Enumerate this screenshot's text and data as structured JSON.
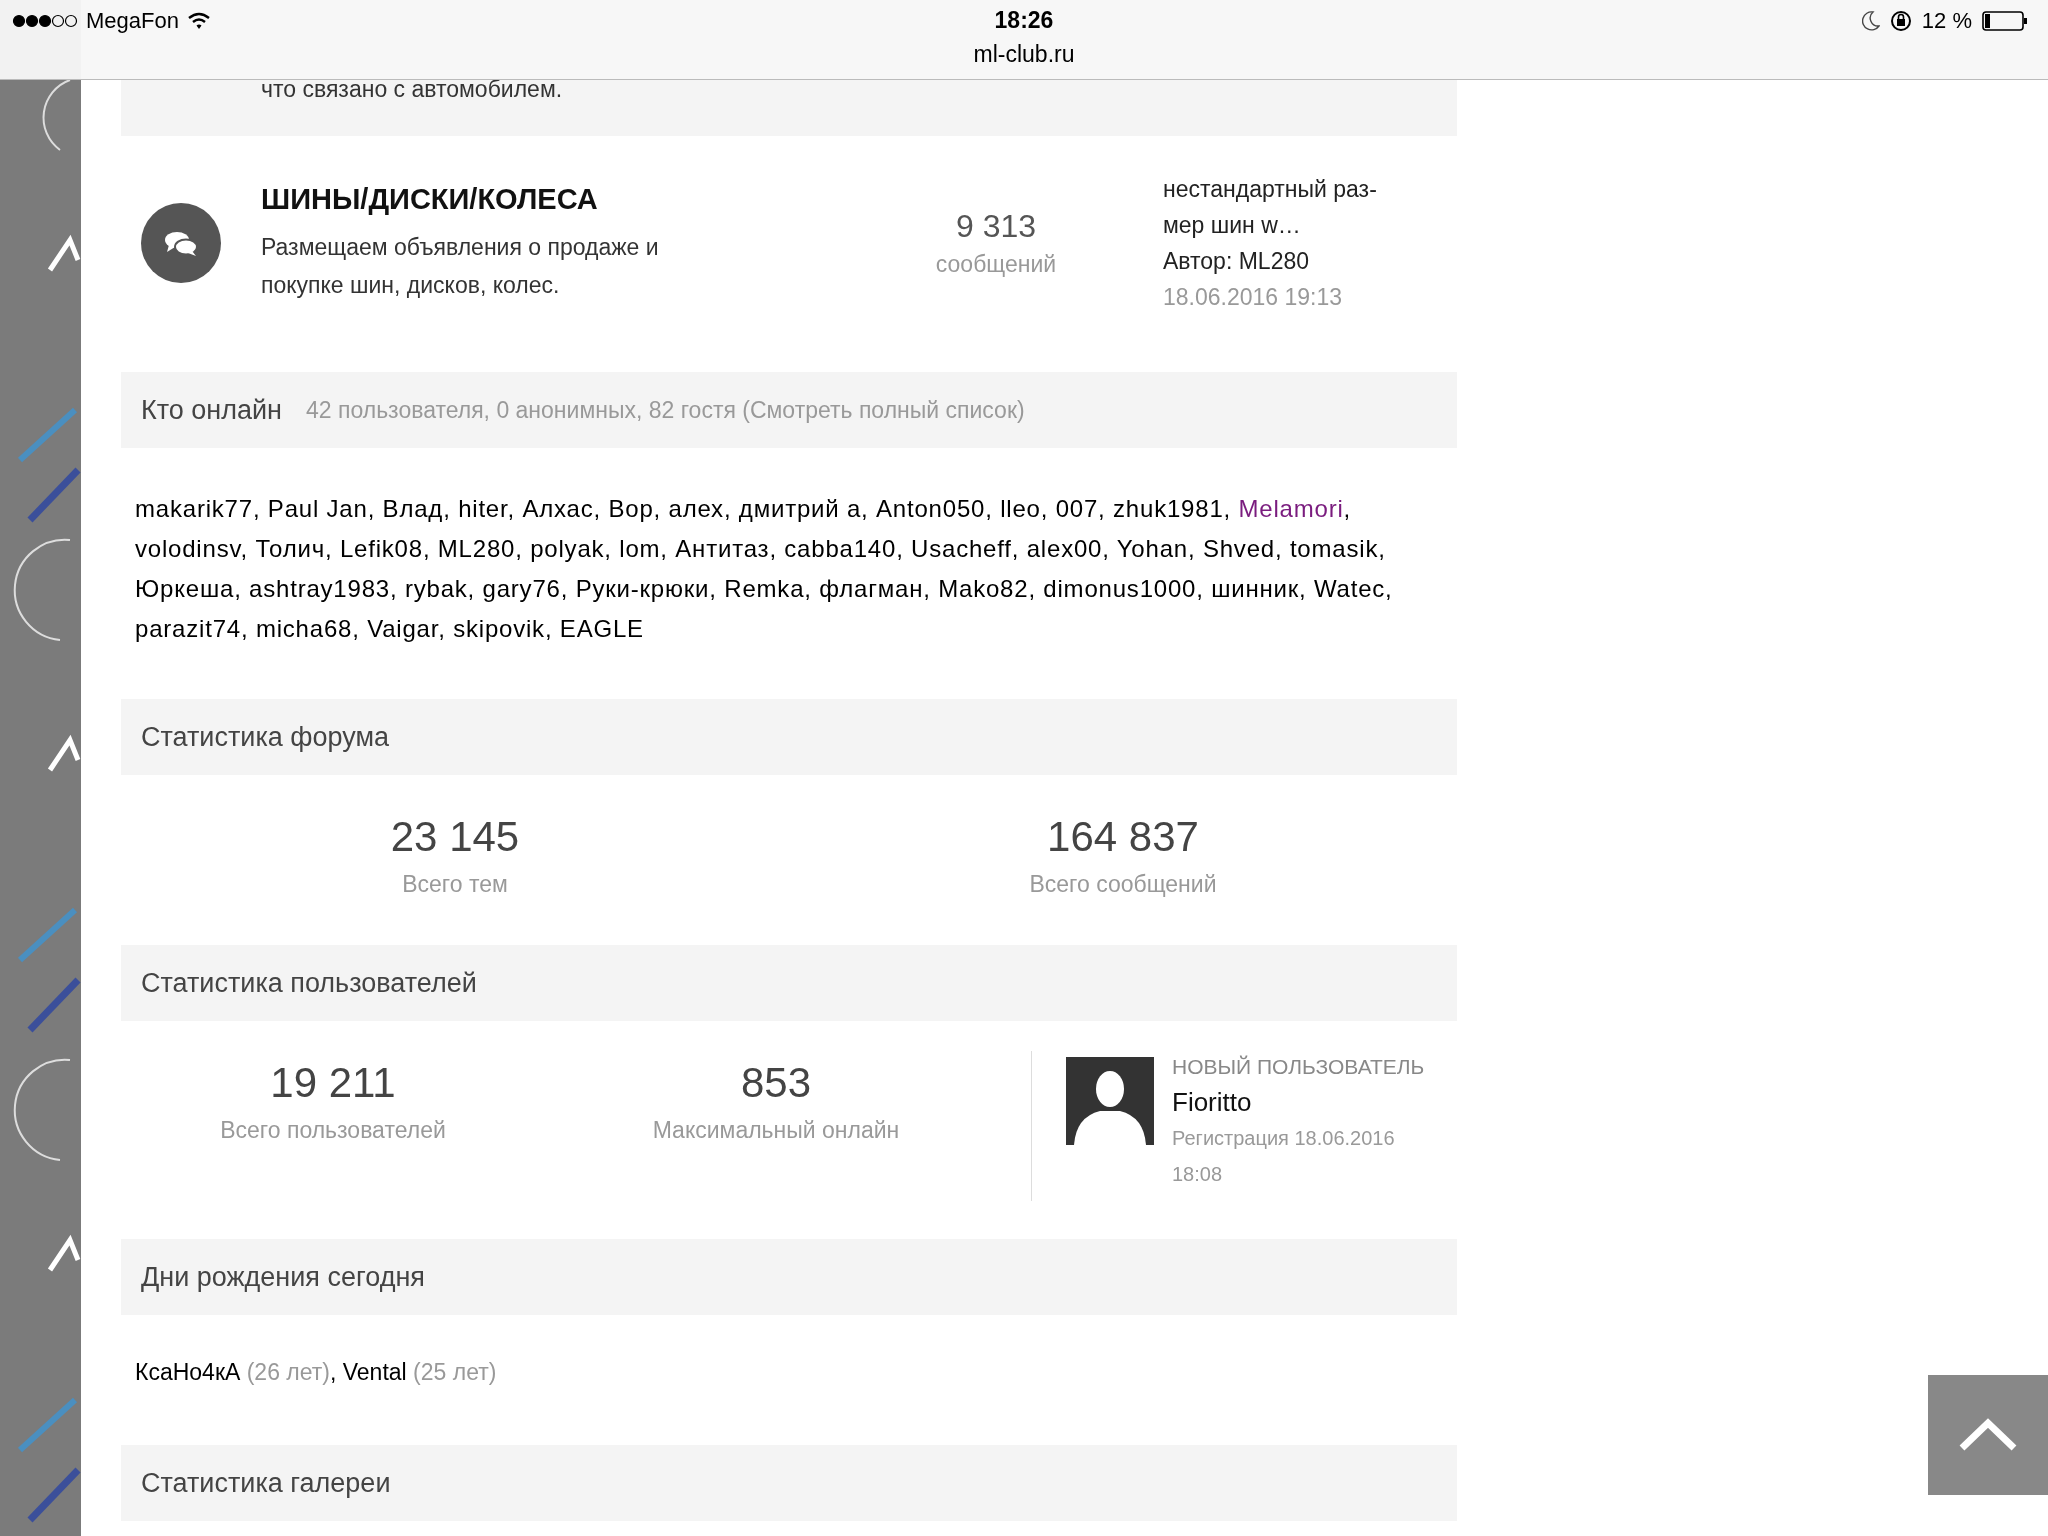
{
  "status_bar": {
    "carrier": "MegaFon",
    "time": "18:26",
    "url": "ml-club.ru",
    "battery": "12 %"
  },
  "previous_forum": {
    "description_tail": "что связано с автомобилем."
  },
  "forum": {
    "title": "ШИНЫ/ДИСКИ/КОЛЕСА",
    "description": "Размещаем объявления о продаже и покупке шин, дисков, колес.",
    "count": "9 313",
    "count_label": "сообщений",
    "last_post": {
      "title_lines": [
        "нестандартный раз-",
        "мер шин w…"
      ],
      "author": "Автор: ML280",
      "date": "18.06.2016 19:13"
    }
  },
  "who_online": {
    "title": "Кто онлайн",
    "separator": ",",
    "summary": "42 пользователя, 0 анонимных, 82 гостя (Смотреть полный список)",
    "users": [
      {
        "name": "makarik77",
        "color": "#000000"
      },
      {
        "name": "Paul Jan",
        "color": "#000000"
      },
      {
        "name": "Влад",
        "color": "#000000"
      },
      {
        "name": "hiter",
        "color": "#000000"
      },
      {
        "name": "Алхас",
        "color": "#000000"
      },
      {
        "name": "Вор",
        "color": "#000000"
      },
      {
        "name": "алех",
        "color": "#000000"
      },
      {
        "name": "дмитрий а",
        "color": "#000000"
      },
      {
        "name": "Anton050",
        "color": "#000000"
      },
      {
        "name": "lleo",
        "color": "#000000"
      },
      {
        "name": "007",
        "color": "#000000"
      },
      {
        "name": "zhuk1981",
        "color": "#000000"
      },
      {
        "name": "Melamori",
        "color": "#7a1c7e"
      },
      {
        "name": "volodinsv",
        "color": "#000000"
      },
      {
        "name": "Толич",
        "color": "#000000"
      },
      {
        "name": "Lefik08",
        "color": "#000000"
      },
      {
        "name": "ML280",
        "color": "#000000"
      },
      {
        "name": "polyak",
        "color": "#000000"
      },
      {
        "name": "lom",
        "color": "#000000"
      },
      {
        "name": "Антитаз",
        "color": "#000000"
      },
      {
        "name": "cabba140",
        "color": "#000000"
      },
      {
        "name": "Usacheff",
        "color": "#000000"
      },
      {
        "name": "alex00",
        "color": "#000000"
      },
      {
        "name": "Yohan",
        "color": "#000000"
      },
      {
        "name": "Shved",
        "color": "#000000"
      },
      {
        "name": "tomasik",
        "color": "#000000"
      },
      {
        "name": "Юркеша",
        "color": "#000000"
      },
      {
        "name": "ashtray1983",
        "color": "#000000"
      },
      {
        "name": "rybak",
        "color": "#000000"
      },
      {
        "name": "gary76",
        "color": "#000000"
      },
      {
        "name": "Руки-крюки",
        "color": "#000000"
      },
      {
        "name": "Remka",
        "color": "#000000"
      },
      {
        "name": "флагман",
        "color": "#000000"
      },
      {
        "name": "Mako82",
        "color": "#000000"
      },
      {
        "name": "dimonus1000",
        "color": "#000000"
      },
      {
        "name": "шинник",
        "color": "#000000"
      },
      {
        "name": "Watec",
        "color": "#000000"
      },
      {
        "name": "parazit74",
        "color": "#000000"
      },
      {
        "name": "micha68",
        "color": "#000000"
      },
      {
        "name": "Vaigar",
        "color": "#000000"
      },
      {
        "name": "skipovik",
        "color": "#000000"
      },
      {
        "name": "EAGLE",
        "color": "#000000"
      }
    ]
  },
  "forum_stats": {
    "title": "Статистика форума",
    "items": [
      {
        "value": "23 145",
        "label": "Всего тем"
      },
      {
        "value": "164 837",
        "label": "Всего сообщений"
      }
    ]
  },
  "user_stats": {
    "title": "Статистика пользователей",
    "items": [
      {
        "value": "19 211",
        "label": "Всего пользователей"
      },
      {
        "value": "853",
        "label": "Максимальный онлайн"
      }
    ],
    "new_user": {
      "heading": "НОВЫЙ ПОЛЬЗОВАТЕЛЬ",
      "name": "Fioritto",
      "registered": "Регистрация 18.06.2016 18:08"
    }
  },
  "birthdays": {
    "title": "Дни рождения сегодня",
    "separator": ",",
    "people": [
      {
        "name": "КсаНо4кА",
        "age": "(26 лет)"
      },
      {
        "name": "Vental",
        "age": "(25 лет)"
      }
    ]
  },
  "gallery_stats": {
    "title": "Статистика галереи"
  }
}
